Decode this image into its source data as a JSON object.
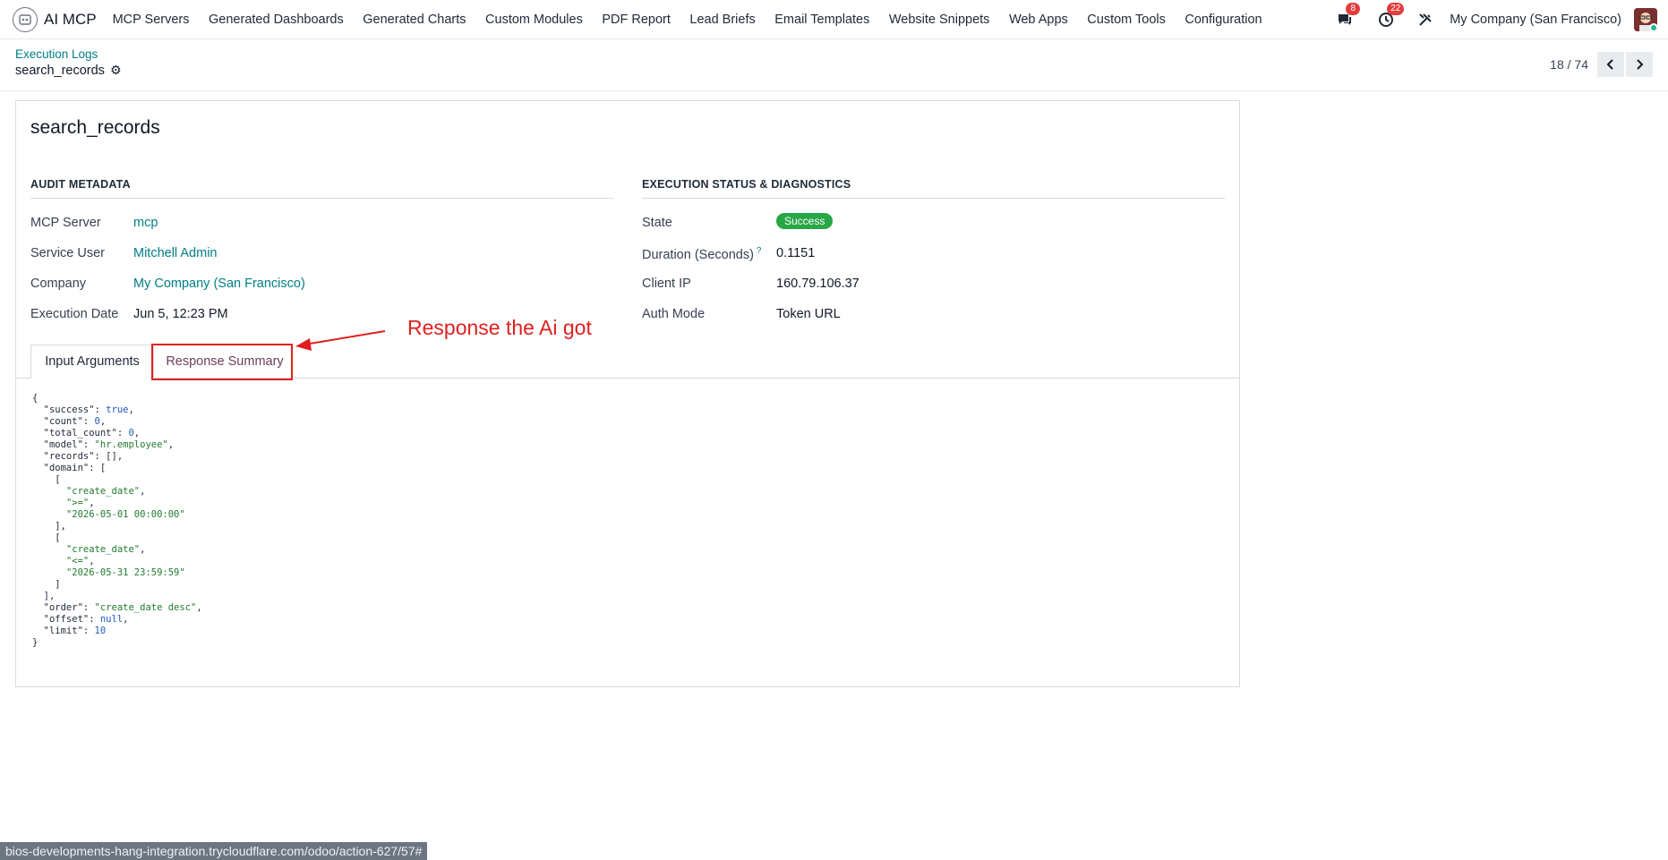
{
  "app": {
    "name": "AI MCP",
    "icon": "ai-mcp-app-icon"
  },
  "menu": [
    "MCP Servers",
    "Generated Dashboards",
    "Generated Charts",
    "Custom Modules",
    "PDF Report",
    "Lead Briefs",
    "Email Templates",
    "Website Snippets",
    "Web Apps",
    "Custom Tools",
    "Configuration"
  ],
  "systray": {
    "messages_badge": "8",
    "activities_badge": "22",
    "company": "My Company (San Francisco)"
  },
  "breadcrumb": {
    "parent": "Execution Logs",
    "current": "search_records"
  },
  "pager": {
    "value": "18 / 74"
  },
  "record": {
    "title": "search_records"
  },
  "audit": {
    "heading": "AUDIT METADATA",
    "mcp_server_label": "MCP Server",
    "mcp_server": "mcp",
    "service_user_label": "Service User",
    "service_user": "Mitchell Admin",
    "company_label": "Company",
    "company": "My Company (San Francisco)",
    "execution_date_label": "Execution Date",
    "execution_date": "Jun 5, 12:23 PM"
  },
  "status": {
    "heading": "EXECUTION STATUS & DIAGNOSTICS",
    "state_label": "State",
    "state": "Success",
    "duration_label": "Duration (Seconds)",
    "duration": "0.1151",
    "client_ip_label": "Client IP",
    "client_ip": "160.79.106.37",
    "auth_mode_label": "Auth Mode",
    "auth_mode": "Token URL"
  },
  "tabs": {
    "input": "Input Arguments",
    "response": "Response Summary"
  },
  "annotation": {
    "text": "Response the Ai got",
    "color": "#e02020"
  },
  "statusbar": {
    "url": "bios-developments-hang-integration.trycloudflare.com/odoo/action-627/57#"
  },
  "colors": {
    "link": "#017e84",
    "success": "#28a745",
    "badge": "#e23d3d"
  }
}
